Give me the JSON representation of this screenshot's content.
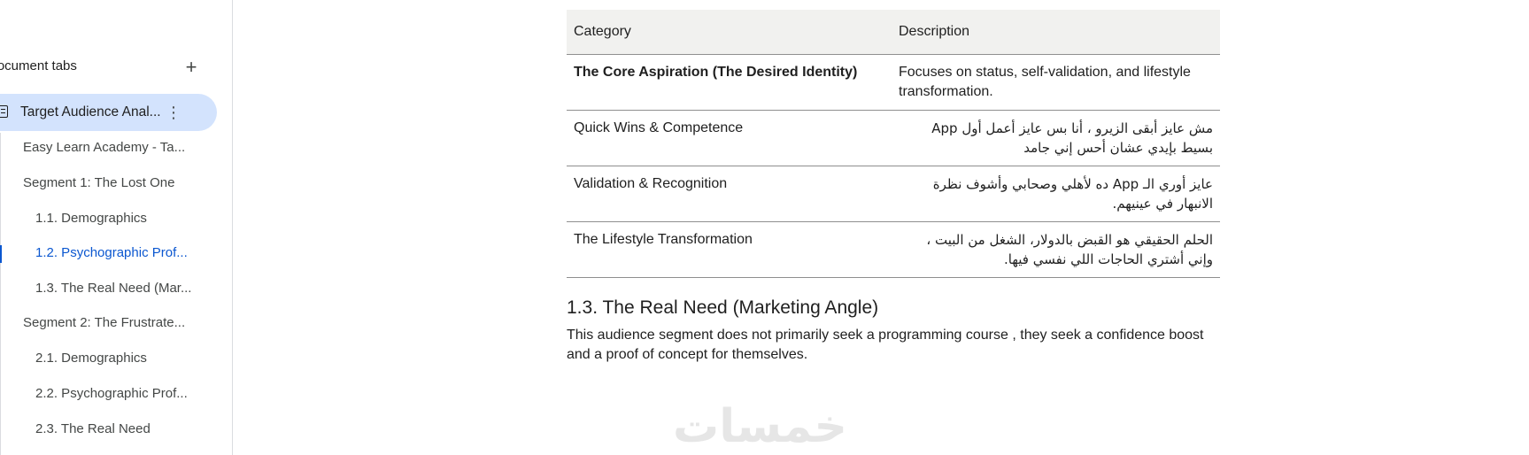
{
  "sidebar": {
    "title": "Document tabs",
    "add_icon": "plus-icon",
    "active_tab": {
      "label": "Target Audience Anal...",
      "icon": "document-icon",
      "menu_icon": "more-vert-icon"
    },
    "items": [
      {
        "label": "Easy Learn Academy - Ta...",
        "level": 1
      },
      {
        "label": "Segment 1: The Lost One",
        "level": 1
      },
      {
        "label": "1.1. Demographics",
        "level": 2
      },
      {
        "label": "1.2. Psychographic Prof...",
        "level": 2,
        "current": true
      },
      {
        "label": "1.3. The Real Need (Mar...",
        "level": 2
      },
      {
        "label": "Segment 2: The Frustrate...",
        "level": 1
      },
      {
        "label": "2.1. Demographics",
        "level": 2
      },
      {
        "label": "2.2. Psychographic Prof...",
        "level": 2
      },
      {
        "label": "2.3. The Real Need",
        "level": 2
      }
    ]
  },
  "document": {
    "table": {
      "headers": [
        "Category",
        "Description"
      ],
      "rows": [
        {
          "category": "The Core Aspiration (The Desired Identity)",
          "description": "Focuses on status, self-validation, and lifestyle transformation.",
          "bold": true,
          "rtl": false
        },
        {
          "category": "Quick Wins & Competence",
          "description": "مش عايز أبقى الزيرو ، أنا بس عايز أعمل أول App بسيط بإيدي عشان أحس إني جامد",
          "bold": false,
          "rtl": true
        },
        {
          "category": "Validation & Recognition",
          "description": "عايز أوري الـ App ده لأهلي وصحابي وأشوف نظرة الانبهار في عينيهم.",
          "bold": false,
          "rtl": true
        },
        {
          "category": "The Lifestyle Transformation",
          "description": "الحلم الحقيقي هو القبض بالدولار، الشغل من البيت ، وإني أشتري الحاجات اللي نفسي فيها.",
          "bold": false,
          "rtl": true
        }
      ]
    },
    "section_heading": "1.3. The Real Need (Marketing Angle)",
    "section_body": "This audience segment does not primarily seek a programming course , they seek a confidence boost and a proof of concept for themselves.",
    "watermark": "خمسات"
  }
}
